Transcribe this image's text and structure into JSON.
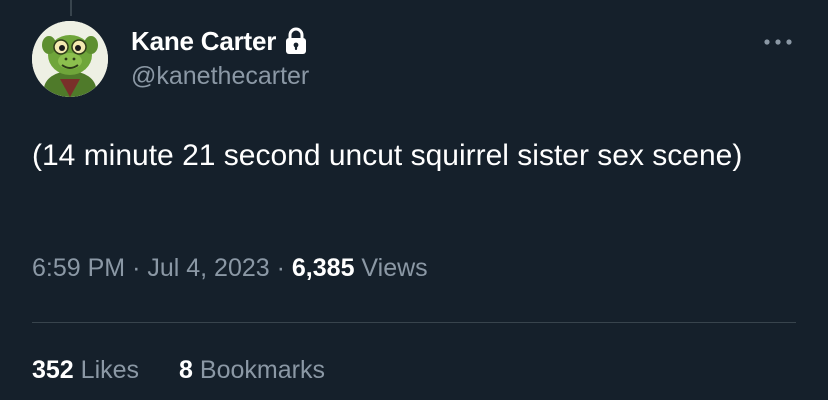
{
  "author": {
    "display_name": "Kane Carter",
    "handle": "@kanethecarter",
    "protected_icon": "lock-icon",
    "avatar": "green-cartoon-character-avatar"
  },
  "tweet": {
    "text": "(14 minute 21 second uncut squirrel sister sex scene)",
    "time": "6:59 PM",
    "date": "Jul 4, 2023",
    "separator": "·",
    "views_count": "6,385",
    "views_label": "Views"
  },
  "stats": {
    "likes_count": "352",
    "likes_label": "Likes",
    "bookmarks_count": "8",
    "bookmarks_label": "Bookmarks"
  },
  "more_icon": "more-horizontal-icon",
  "colors": {
    "background": "#15202b",
    "primary_text": "#ffffff",
    "secondary_text": "#8b98a5",
    "divider": "#38444d"
  }
}
